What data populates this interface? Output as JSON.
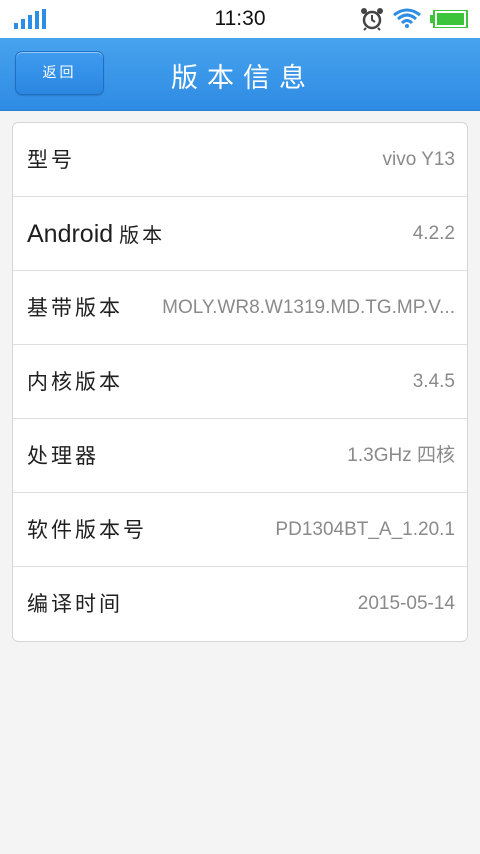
{
  "status_bar": {
    "time": "11:30",
    "icons": [
      "signal-icon",
      "alarm-icon",
      "wifi-icon",
      "battery-icon"
    ]
  },
  "header": {
    "back_label": "返回",
    "title": "版本信息"
  },
  "info_rows": [
    {
      "label": "型号",
      "value": "vivo Y13"
    },
    {
      "label_latin": "Android",
      "label": "版本",
      "value": "4.2.2"
    },
    {
      "label": "基带版本",
      "value": "MOLY.WR8.W1319.MD.TG.MP.V..."
    },
    {
      "label": "内核版本",
      "value": "3.4.5"
    },
    {
      "label": "处理器",
      "value": "1.3GHz 四核"
    },
    {
      "label": "软件版本号",
      "value": "PD1304BT_A_1.20.1"
    },
    {
      "label": "编译时间",
      "value": "2015-05-14"
    }
  ],
  "colors": {
    "header_blue": "#3a97ea",
    "battery_green": "#3ec43a",
    "value_gray": "#8a8a8a"
  }
}
